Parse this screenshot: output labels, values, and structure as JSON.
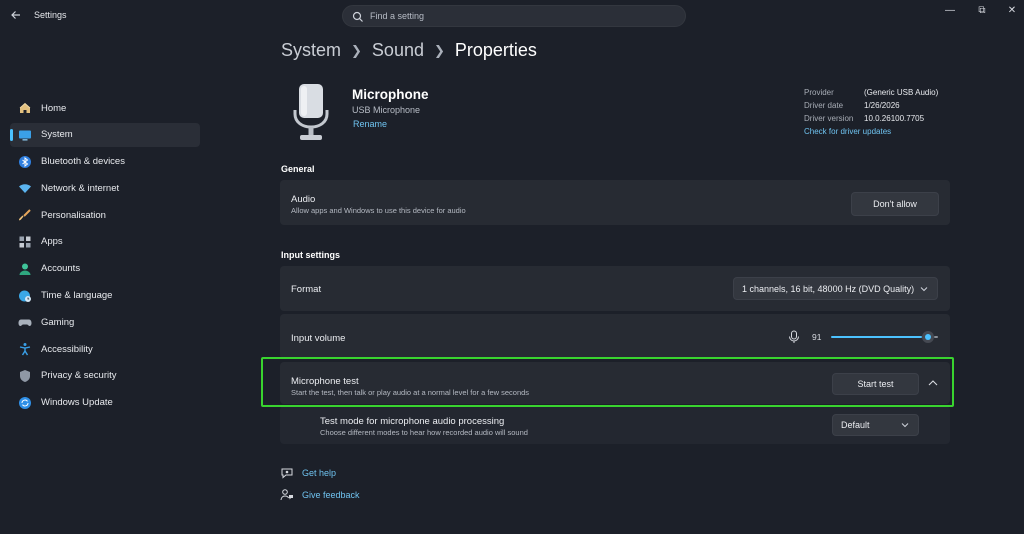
{
  "window": {
    "app_title": "Settings",
    "minimize": "—",
    "maximize": "⧉",
    "close": "✕"
  },
  "search": {
    "placeholder": "Find a setting"
  },
  "sidebar": {
    "items": [
      {
        "label": "Home",
        "icon": "home-icon",
        "active": false
      },
      {
        "label": "System",
        "icon": "system-icon",
        "active": true
      },
      {
        "label": "Bluetooth & devices",
        "icon": "bluetooth-icon",
        "active": false
      },
      {
        "label": "Network & internet",
        "icon": "wifi-icon",
        "active": false
      },
      {
        "label": "Personalisation",
        "icon": "brush-icon",
        "active": false
      },
      {
        "label": "Apps",
        "icon": "apps-icon",
        "active": false
      },
      {
        "label": "Accounts",
        "icon": "accounts-icon",
        "active": false
      },
      {
        "label": "Time & language",
        "icon": "globe-clock-icon",
        "active": false
      },
      {
        "label": "Gaming",
        "icon": "gamepad-icon",
        "active": false
      },
      {
        "label": "Accessibility",
        "icon": "accessibility-icon",
        "active": false
      },
      {
        "label": "Privacy & security",
        "icon": "shield-icon",
        "active": false
      },
      {
        "label": "Windows Update",
        "icon": "update-icon",
        "active": false
      }
    ]
  },
  "breadcrumb": {
    "part1": "System",
    "part2": "Sound",
    "current": "Properties"
  },
  "device": {
    "name": "Microphone",
    "subtitle": "USB Microphone",
    "rename_label": "Rename",
    "provider_label": "Provider",
    "provider_value": "(Generic USB Audio)",
    "driver_date_label": "Driver date",
    "driver_date_value": "1/26/2026",
    "driver_version_label": "Driver version",
    "driver_version_value": "10.0.26100.7705",
    "driver_update_link": "Check for driver updates"
  },
  "general": {
    "title": "General",
    "audio_title": "Audio",
    "audio_desc": "Allow apps and Windows to use this device for audio",
    "audio_button": "Don't allow"
  },
  "input_settings": {
    "title": "Input settings",
    "format_title": "Format",
    "format_value": "1 channels, 16 bit, 48000 Hz (DVD Quality)",
    "volume_title": "Input volume",
    "volume_value": "91",
    "volume_level": 0.91,
    "mic_test_title": "Microphone test",
    "mic_test_desc": "Start the test, then talk or play audio at a normal level for a few seconds",
    "mic_test_button": "Start test",
    "test_mode_title": "Test mode for microphone audio processing",
    "test_mode_desc": "Choose different modes to hear how recorded audio will sound",
    "test_mode_value": "Default"
  },
  "footer": {
    "help_label": "Get help",
    "feedback_label": "Give feedback"
  },
  "colors": {
    "accent": "#4cc2ff",
    "link": "#6fc3f0",
    "background": "#1c2029",
    "card": "#272b33",
    "highlight": "#39d42f"
  }
}
